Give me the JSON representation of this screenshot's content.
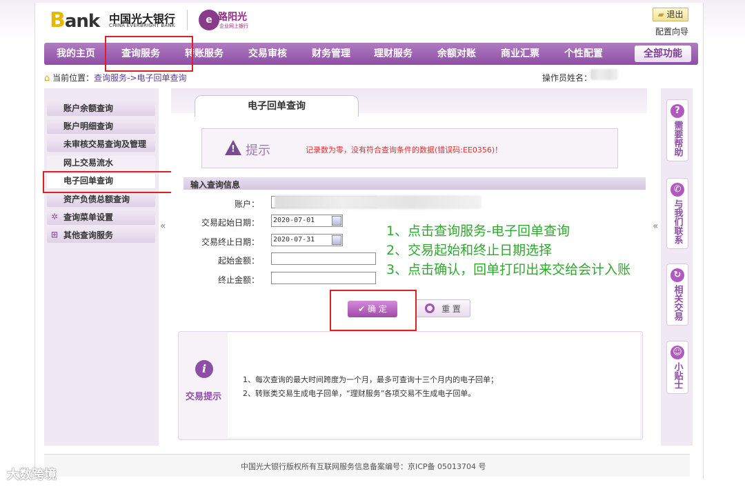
{
  "header": {
    "bank_logo": "Bank",
    "bank_name_cn": "中国光大银行",
    "bank_name_en": "CHINA EVERBRIGHT BANK",
    "partner_logo": "路阳光",
    "partner_sub": "企业网上银行",
    "logout_label": "退出",
    "config_guide_label": "配置向导"
  },
  "nav": {
    "items": [
      "我的主页",
      "查询服务",
      "转账服务",
      "交易审核",
      "财务管理",
      "理财服务",
      "余额对账",
      "商业汇票",
      "个性配置"
    ],
    "all_functions": "全部功能"
  },
  "breadcrumb": {
    "label": "当前位置：",
    "path": "查询服务->电子回单查询",
    "operator_label": "操作员姓名："
  },
  "sidebar": {
    "items": [
      "账户余额查询",
      "账户明细查询",
      "未审核交易查询及管理",
      "网上交易流水",
      "电子回单查询",
      "资产负债总额查询",
      "查询菜单设置",
      "其他查询服务"
    ]
  },
  "right_sidebar": {
    "tabs": [
      "需要帮助",
      "与我们联系",
      "相关交易",
      "小贴士"
    ]
  },
  "main": {
    "tab_title": "电子回单查询",
    "tip_title": "提示",
    "tip_message": "记录数为零，没有符合查询条件的数据(错误码:EE0356)！",
    "section_title": "输入查询信息",
    "fields": {
      "account_label": "账户：",
      "start_date_label": "交易起始日期：",
      "start_date_value": "2020-07-01",
      "end_date_label": "交易终止日期：",
      "end_date_value": "2020-07-31",
      "min_amount_label": "起始金额：",
      "max_amount_label": "终止金额："
    },
    "confirm_label": "确 定",
    "reset_label": "重 置",
    "notes_label": "交易提示",
    "notes": [
      "1、每次查询的最大时间跨度为一个月，最多可查询十三个月内的电子回单；",
      "2、转账类交易生成电子回单，“理财服务”各项交易不生成电子回单。"
    ]
  },
  "instructions": [
    "1、点击查询服务-电子回单查询",
    "2、交易起始和终止日期选择",
    "3、点击确认，回单打印出来交给会计入账"
  ],
  "footer": "中国光大银行版权所有互联网服务信息备案编号：京ICP备 05013704 号",
  "watermark": "大数跨境",
  "colors": {
    "nav_purple": "#8d4ea6",
    "highlight_red": "#e02020",
    "instruction_green": "#2ea82e",
    "error_red": "#e03030"
  }
}
